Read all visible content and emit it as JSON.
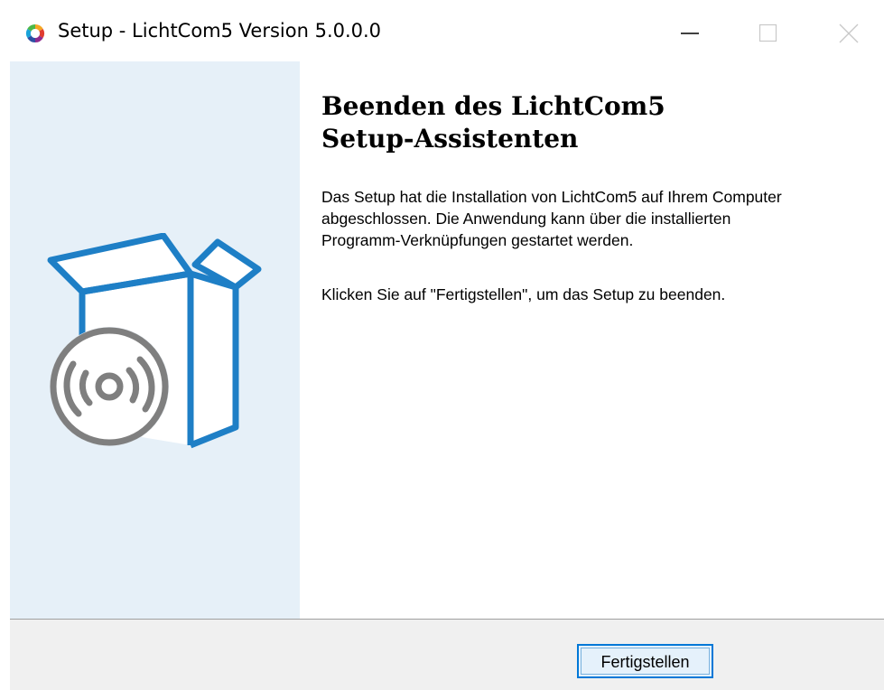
{
  "window": {
    "title": "Setup - LichtCom5 Version 5.0.0.0",
    "icon": "lichtcom-ring-icon"
  },
  "caption_buttons": {
    "minimize": "minimize-icon",
    "maximize": "maximize-icon",
    "close": "close-icon"
  },
  "sidebar": {
    "illustration": "software-box-with-disc-icon",
    "background_color": "#e6f0f8",
    "accent_color": "#1e7fc6"
  },
  "main": {
    "heading": "Beenden des LichtCom5 Setup-Assistenten",
    "paragraph1": "Das Setup hat die Installation von LichtCom5 auf Ihrem Computer abgeschlossen. Die Anwendung kann über die installierten Programm-Verknüpfungen gestartet werden.",
    "paragraph2": "Klicken Sie auf \"Fertigstellen\", um das Setup zu beenden."
  },
  "footer": {
    "finish_label": "Fertigstellen"
  }
}
